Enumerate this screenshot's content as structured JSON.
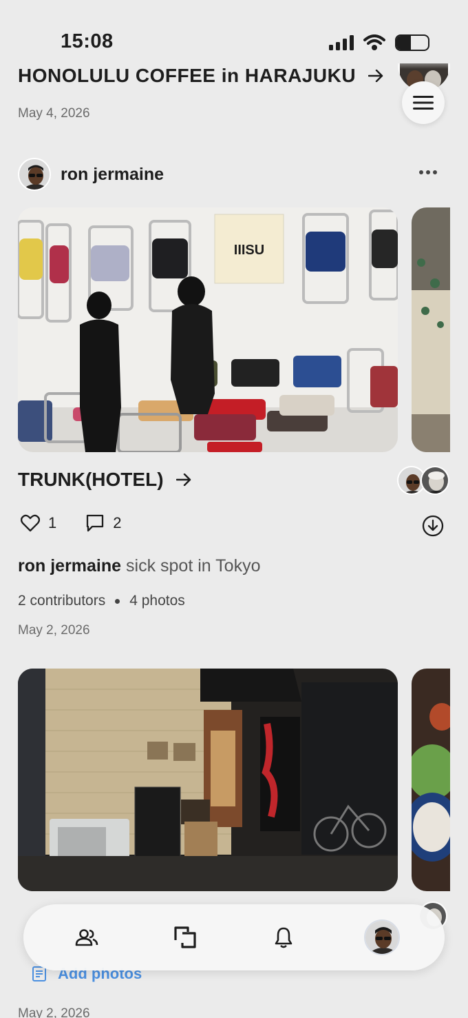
{
  "status_bar": {
    "time": "15:08",
    "battery_level": 0.45
  },
  "feed": {
    "top_post": {
      "title": "HONOLULU COFFEE in HARAJUKU",
      "date": "May 4, 2026"
    },
    "post": {
      "author": "ron jermaine",
      "title": "TRUNK(HOTEL)",
      "sign_text": "IIISU",
      "likes": "1",
      "comments": "2",
      "caption_author": "ron jermaine",
      "caption_text": "sick spot in Tokyo",
      "contributors": "2 contributors",
      "photos": "4 photos",
      "date": "May 2, 2026"
    },
    "next_post": {
      "add_photos_label": "Add photos",
      "date": "May 2, 2026"
    }
  },
  "icons": {
    "menu": "hamburger-icon",
    "more": "ellipsis-icon",
    "arrow": "arrow-right-icon",
    "like": "heart-icon",
    "comment": "chat-bubble-icon",
    "download": "download-circle-icon",
    "add_photos": "document-icon",
    "nav": [
      "people-icon",
      "frames-icon",
      "bell-icon",
      "profile-avatar"
    ]
  },
  "colors": {
    "accent": "#4a8fe0",
    "background": "#ebebeb"
  }
}
